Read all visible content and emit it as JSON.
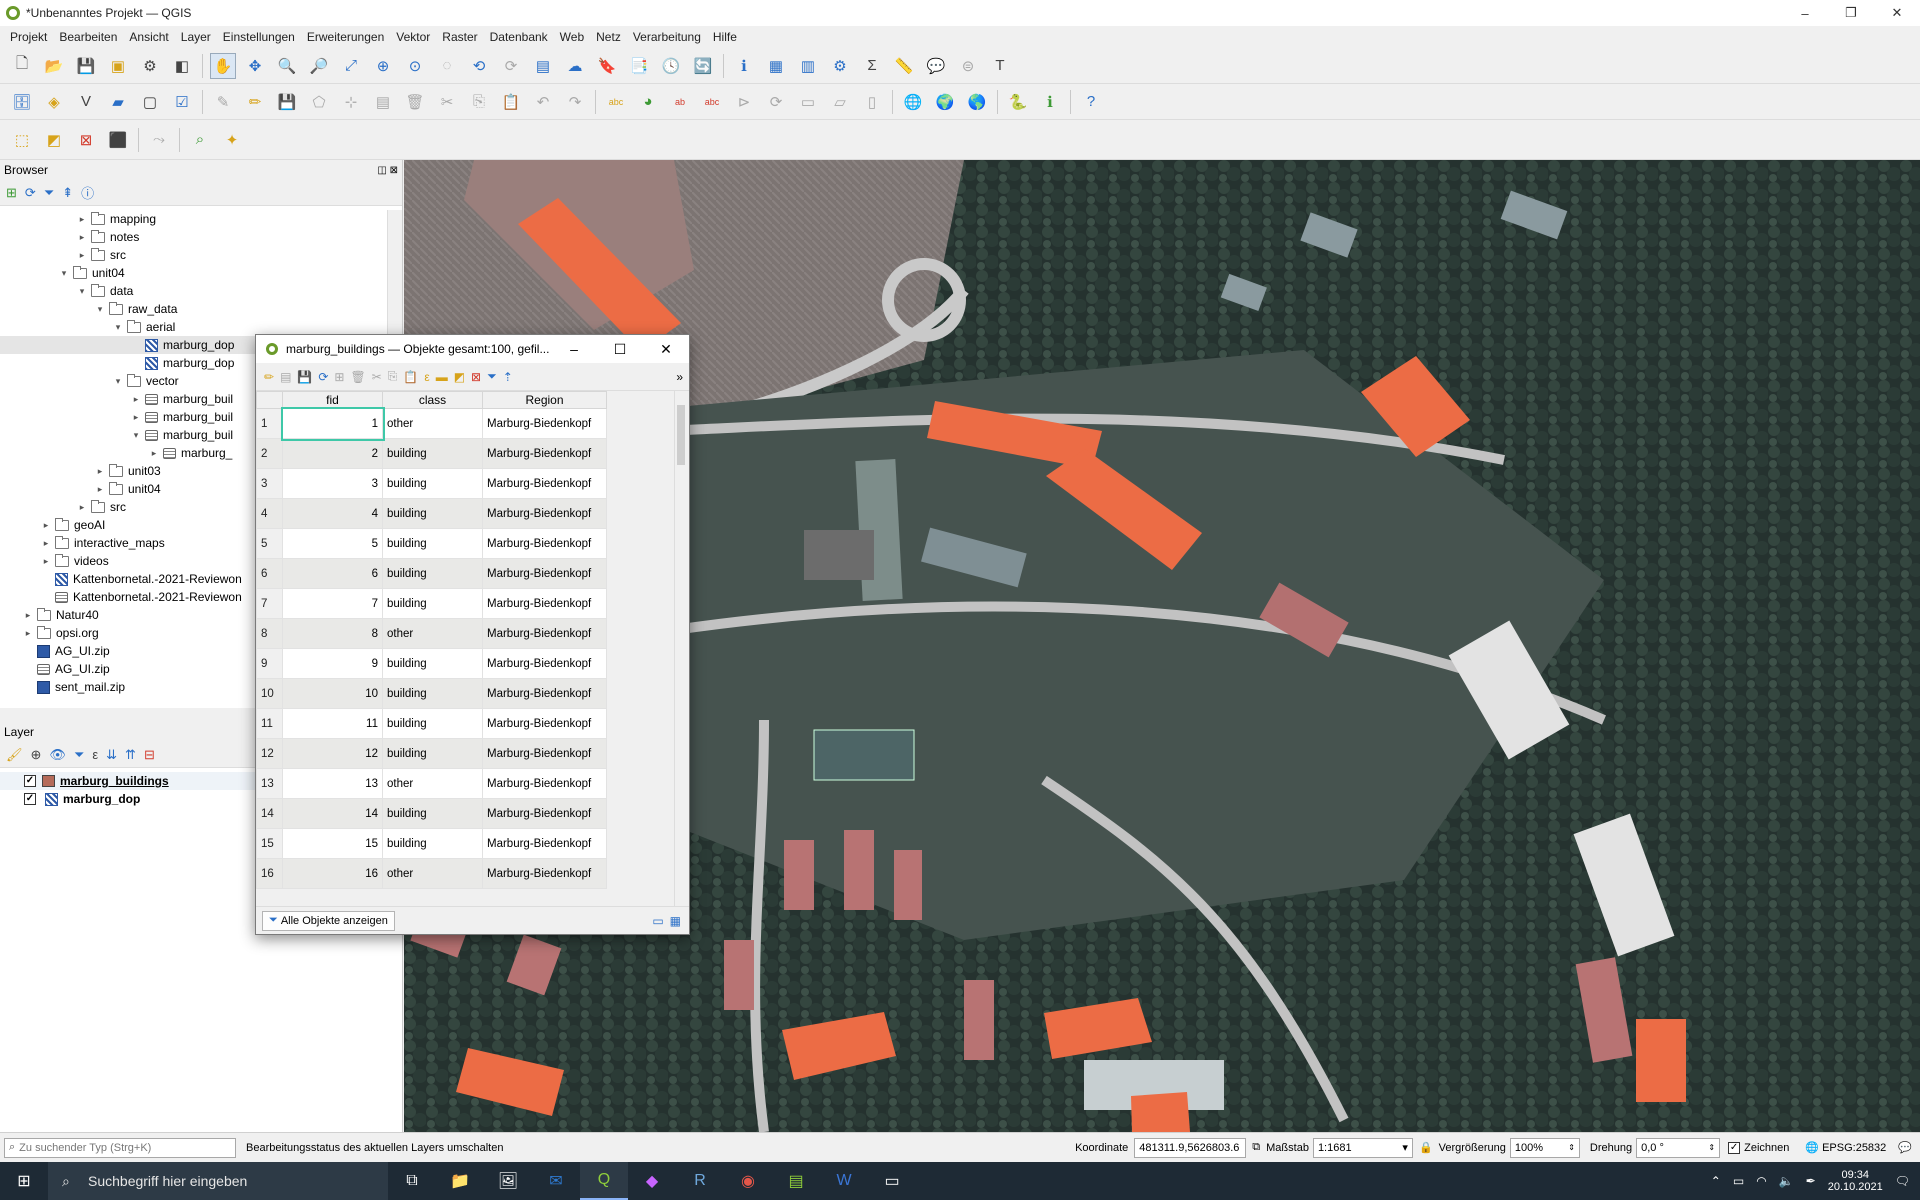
{
  "window": {
    "title": "*Unbenanntes Projekt — QGIS",
    "minimize_icon": "–",
    "restore_icon": "❐",
    "close_icon": "✕"
  },
  "menu": [
    "Projekt",
    "Bearbeiten",
    "Ansicht",
    "Layer",
    "Einstellungen",
    "Erweiterungen",
    "Vektor",
    "Raster",
    "Datenbank",
    "Web",
    "Netz",
    "Verarbeitung",
    "Hilfe"
  ],
  "browser": {
    "title": "Browser",
    "tree": [
      {
        "label": "mapping",
        "type": "folder",
        "indent": 3,
        "arrow": "▸"
      },
      {
        "label": "notes",
        "type": "folder",
        "indent": 3,
        "arrow": "▸"
      },
      {
        "label": "src",
        "type": "folder",
        "indent": 3,
        "arrow": "▸"
      },
      {
        "label": "unit04",
        "type": "folder",
        "indent": 2,
        "arrow": "▾"
      },
      {
        "label": "data",
        "type": "folder",
        "indent": 3,
        "arrow": "▾"
      },
      {
        "label": "raw_data",
        "type": "folder",
        "indent": 4,
        "arrow": "▾"
      },
      {
        "label": "aerial",
        "type": "folder",
        "indent": 5,
        "arrow": "▾"
      },
      {
        "label": "marburg_dop",
        "type": "raster",
        "indent": 6,
        "arrow": ""
      },
      {
        "label": "marburg_dop",
        "type": "raster",
        "indent": 6,
        "arrow": ""
      },
      {
        "label": "vector",
        "type": "folder",
        "indent": 5,
        "arrow": "▾"
      },
      {
        "label": "marburg_buil",
        "type": "vector",
        "indent": 6,
        "arrow": "▸"
      },
      {
        "label": "marburg_buil",
        "type": "vector",
        "indent": 6,
        "arrow": "▸"
      },
      {
        "label": "marburg_buil",
        "type": "vector",
        "indent": 6,
        "arrow": "▾"
      },
      {
        "label": "marburg_",
        "type": "polygon",
        "indent": 7,
        "arrow": "▸"
      },
      {
        "label": "unit03",
        "type": "folder",
        "indent": 4,
        "arrow": "▸"
      },
      {
        "label": "unit04",
        "type": "folder",
        "indent": 4,
        "arrow": "▸"
      },
      {
        "label": "src",
        "type": "folder",
        "indent": 3,
        "arrow": "▸"
      },
      {
        "label": "geoAI",
        "type": "folder",
        "indent": 1,
        "arrow": "▸"
      },
      {
        "label": "interactive_maps",
        "type": "folder",
        "indent": 1,
        "arrow": "▸"
      },
      {
        "label": "videos",
        "type": "folder",
        "indent": 1,
        "arrow": "▸"
      },
      {
        "label": "Kattenbornetal.-2021-Reviewon",
        "type": "raster",
        "indent": 1,
        "arrow": ""
      },
      {
        "label": "Kattenbornetal.-2021-Reviewon",
        "type": "vector",
        "indent": 1,
        "arrow": ""
      },
      {
        "label": "Natur40",
        "type": "folder",
        "indent": 0,
        "arrow": "▸"
      },
      {
        "label": "opsi.org",
        "type": "folder",
        "indent": 0,
        "arrow": "▸"
      },
      {
        "label": "AG_UI.zip",
        "type": "zip",
        "indent": 0,
        "arrow": ""
      },
      {
        "label": "AG_UI.zip",
        "type": "polygon",
        "indent": 0,
        "arrow": ""
      },
      {
        "label": "sent_mail.zip",
        "type": "zip",
        "indent": 0,
        "arrow": ""
      }
    ]
  },
  "layers": {
    "title": "Layer",
    "items": [
      {
        "name": "marburg_buildings",
        "type": "polygon",
        "checked": true
      },
      {
        "name": "marburg_dop",
        "type": "raster",
        "checked": true
      }
    ]
  },
  "attribute_table": {
    "title": "marburg_buildings — Objekte gesamt:100, gefil...",
    "columns": [
      "fid",
      "class",
      "Region"
    ],
    "rows": [
      {
        "n": "1",
        "fid": "1",
        "class": "other",
        "region": "Marburg-Biedenkopf"
      },
      {
        "n": "2",
        "fid": "2",
        "class": "building",
        "region": "Marburg-Biedenkopf"
      },
      {
        "n": "3",
        "fid": "3",
        "class": "building",
        "region": "Marburg-Biedenkopf"
      },
      {
        "n": "4",
        "fid": "4",
        "class": "building",
        "region": "Marburg-Biedenkopf"
      },
      {
        "n": "5",
        "fid": "5",
        "class": "building",
        "region": "Marburg-Biedenkopf"
      },
      {
        "n": "6",
        "fid": "6",
        "class": "building",
        "region": "Marburg-Biedenkopf"
      },
      {
        "n": "7",
        "fid": "7",
        "class": "building",
        "region": "Marburg-Biedenkopf"
      },
      {
        "n": "8",
        "fid": "8",
        "class": "other",
        "region": "Marburg-Biedenkopf"
      },
      {
        "n": "9",
        "fid": "9",
        "class": "building",
        "region": "Marburg-Biedenkopf"
      },
      {
        "n": "10",
        "fid": "10",
        "class": "building",
        "region": "Marburg-Biedenkopf"
      },
      {
        "n": "11",
        "fid": "11",
        "class": "building",
        "region": "Marburg-Biedenkopf"
      },
      {
        "n": "12",
        "fid": "12",
        "class": "building",
        "region": "Marburg-Biedenkopf"
      },
      {
        "n": "13",
        "fid": "13",
        "class": "other",
        "region": "Marburg-Biedenkopf"
      },
      {
        "n": "14",
        "fid": "14",
        "class": "building",
        "region": "Marburg-Biedenkopf"
      },
      {
        "n": "15",
        "fid": "15",
        "class": "building",
        "region": "Marburg-Biedenkopf"
      },
      {
        "n": "16",
        "fid": "16",
        "class": "other",
        "region": "Marburg-Biedenkopf"
      }
    ],
    "filter_button": "Alle Objekte anzeigen"
  },
  "status": {
    "locator_placeholder": "Zu suchender Typ (Strg+K)",
    "message": "Bearbeitungsstatus des aktuellen Layers umschalten",
    "coord_label": "Koordinate",
    "coord_value": "481311.9,5626803.6",
    "scale_label": "Maßstab",
    "scale_value": "1:1681",
    "zoom_label": "Vergrößerung",
    "zoom_value": "100%",
    "rotation_label": "Drehung",
    "rotation_value": "0,0 °",
    "render_label": "Zeichnen",
    "crs": "EPSG:25832"
  },
  "taskbar": {
    "search_placeholder": "Suchbegriff hier eingeben",
    "time": "09:34",
    "date": "20.10.2021"
  },
  "colors": {
    "building_fill": "#ec6c45",
    "accent": "#3d8f3d"
  }
}
